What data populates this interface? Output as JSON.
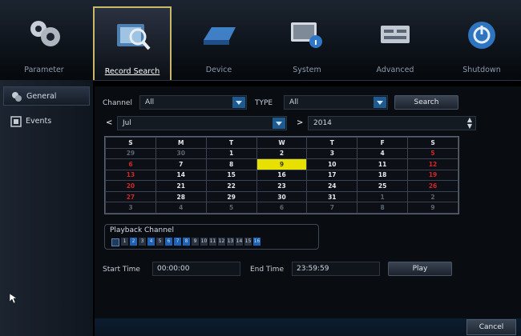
{
  "nav": {
    "items": [
      {
        "label": "Parameter",
        "icon": "gears-icon"
      },
      {
        "label": "Record Search",
        "icon": "record-search-icon"
      },
      {
        "label": "Device",
        "icon": "hard-drive-icon"
      },
      {
        "label": "System",
        "icon": "system-monitor-icon"
      },
      {
        "label": "Advanced",
        "icon": "advanced-panel-icon"
      },
      {
        "label": "Shutdown",
        "icon": "power-icon"
      }
    ],
    "active_index": 1
  },
  "sidebar": {
    "items": [
      {
        "label": "General",
        "icon": "general-icon",
        "active": true
      },
      {
        "label": "Events",
        "icon": "events-icon",
        "active": false
      }
    ]
  },
  "filters": {
    "channel_label": "Channel",
    "channel_value": "All",
    "type_label": "TYPE",
    "type_value": "All",
    "search_label": "Search"
  },
  "month_bar": {
    "prev_symbol": "<",
    "month_value": "Jul",
    "next_symbol": ">",
    "year_value": "2014"
  },
  "calendar": {
    "weekdays": [
      "S",
      "M",
      "T",
      "W",
      "T",
      "F",
      "S"
    ],
    "weeks": [
      [
        "29",
        "30",
        "1",
        "2",
        "3",
        "4",
        "5"
      ],
      [
        "6",
        "7",
        "8",
        "9",
        "10",
        "11",
        "12"
      ],
      [
        "13",
        "14",
        "15",
        "16",
        "17",
        "18",
        "19"
      ],
      [
        "20",
        "21",
        "22",
        "23",
        "24",
        "25",
        "26"
      ],
      [
        "27",
        "28",
        "29",
        "30",
        "31",
        "1",
        "2"
      ],
      [
        "3",
        "4",
        "5",
        "6",
        "7",
        "8",
        "9"
      ]
    ],
    "selected_day": "9"
  },
  "playback": {
    "title": "Playback Channel",
    "channels": [
      "1",
      "2",
      "3",
      "4",
      "5",
      "6",
      "7",
      "8",
      "9",
      "10",
      "11",
      "12",
      "13",
      "14",
      "15",
      "16"
    ]
  },
  "time": {
    "start_label": "Start Time",
    "start_value": "00:00:00",
    "end_label": "End Time",
    "end_value": "23:59:59",
    "play_label": "Play"
  },
  "footer": {
    "cancel_label": "Cancel"
  },
  "colors": {
    "accent": "#1d62b5",
    "selected_day": "#e7e000",
    "sunday": "#d22626",
    "active_border": "#c8b86a"
  }
}
